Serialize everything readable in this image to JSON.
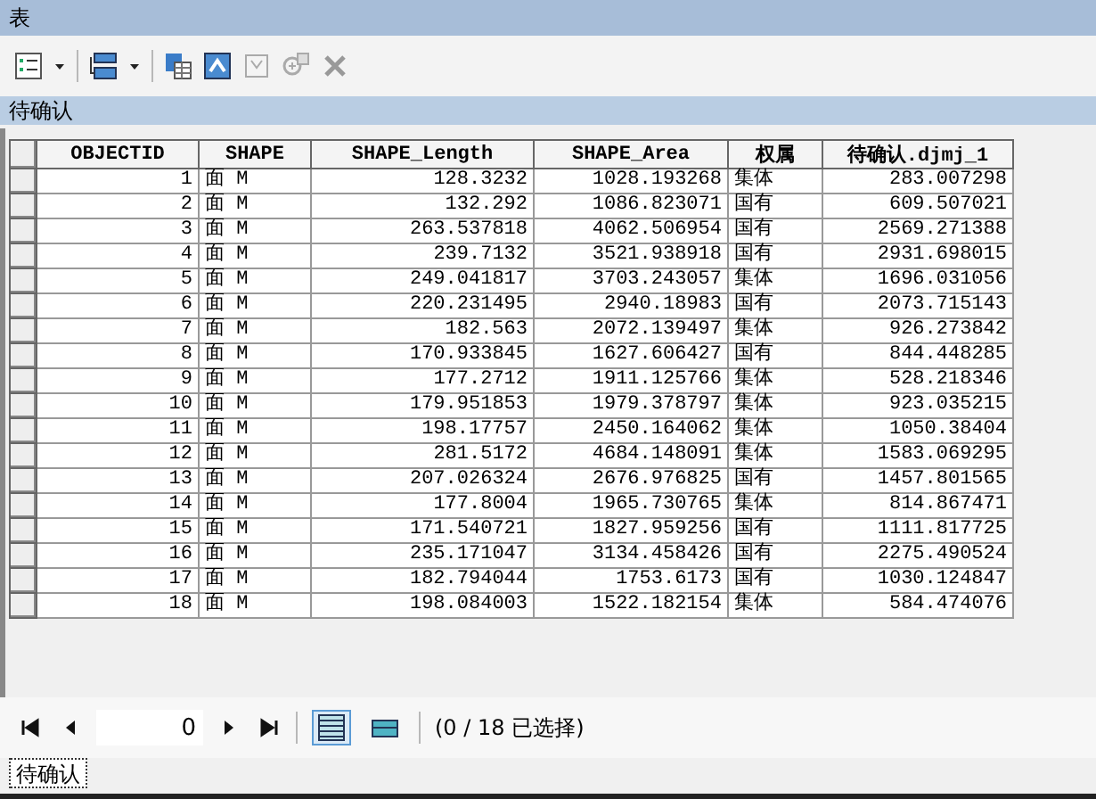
{
  "window": {
    "title": "表"
  },
  "table_title": "待确认",
  "table": {
    "columns": [
      "OBJECTID",
      "SHAPE",
      "SHAPE_Length",
      "SHAPE_Area",
      "权属",
      "待确认.djmj_1"
    ],
    "rows": [
      [
        "1",
        "面 M",
        "128.3232",
        "1028.193268",
        "集体",
        "283.007298"
      ],
      [
        "2",
        "面 M",
        "132.292",
        "1086.823071",
        "国有",
        "609.507021"
      ],
      [
        "3",
        "面 M",
        "263.537818",
        "4062.506954",
        "国有",
        "2569.271388"
      ],
      [
        "4",
        "面 M",
        "239.7132",
        "3521.938918",
        "国有",
        "2931.698015"
      ],
      [
        "5",
        "面 M",
        "249.041817",
        "3703.243057",
        "集体",
        "1696.031056"
      ],
      [
        "6",
        "面 M",
        "220.231495",
        "2940.18983",
        "国有",
        "2073.715143"
      ],
      [
        "7",
        "面 M",
        "182.563",
        "2072.139497",
        "集体",
        "926.273842"
      ],
      [
        "8",
        "面 M",
        "170.933845",
        "1627.606427",
        "国有",
        "844.448285"
      ],
      [
        "9",
        "面 M",
        "177.2712",
        "1911.125766",
        "集体",
        "528.218346"
      ],
      [
        "10",
        "面 M",
        "179.951853",
        "1979.378797",
        "集体",
        "923.035215"
      ],
      [
        "11",
        "面 M",
        "198.17757",
        "2450.164062",
        "集体",
        "1050.38404"
      ],
      [
        "12",
        "面 M",
        "281.5172",
        "4684.148091",
        "集体",
        "1583.069295"
      ],
      [
        "13",
        "面 M",
        "207.026324",
        "2676.976825",
        "国有",
        "1457.801565"
      ],
      [
        "14",
        "面 M",
        "177.8004",
        "1965.730765",
        "集体",
        "814.867471"
      ],
      [
        "15",
        "面 M",
        "171.540721",
        "1827.959256",
        "国有",
        "1111.817725"
      ],
      [
        "16",
        "面 M",
        "235.171047",
        "3134.458426",
        "国有",
        "2275.490524"
      ],
      [
        "17",
        "面 M",
        "182.794044",
        "1753.6173",
        "国有",
        "1030.124847"
      ],
      [
        "18",
        "面 M",
        "198.084003",
        "1522.182154",
        "集体",
        "584.474076"
      ]
    ]
  },
  "navigator": {
    "record": "0",
    "views": [
      {
        "selected": true
      },
      {
        "selected": false
      }
    ],
    "status": "(0 / 18 已选择)"
  },
  "bottom_tabs": [
    {
      "label": "待确认",
      "selected": true
    }
  ]
}
